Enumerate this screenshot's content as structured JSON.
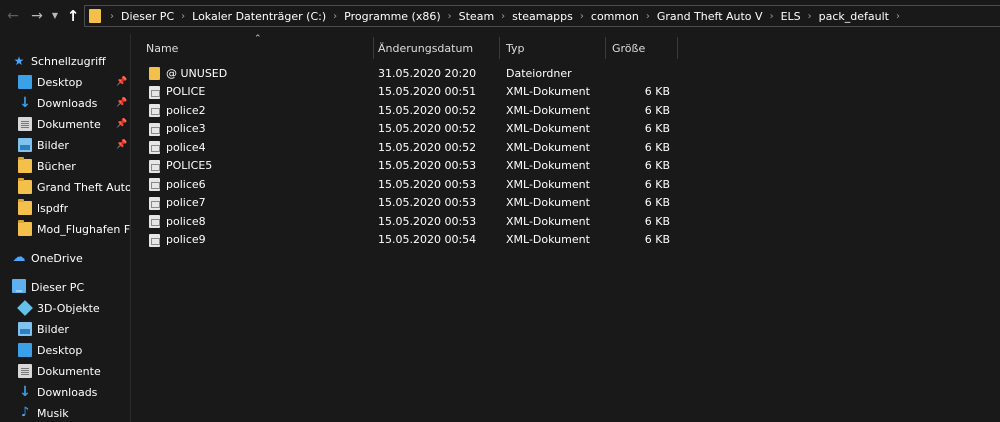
{
  "address_bar": {
    "crumbs": [
      "Dieser PC",
      "Lokaler Datenträger (C:)",
      "Programme (x86)",
      "Steam",
      "steamapps",
      "common",
      "Grand Theft Auto V",
      "ELS",
      "pack_default"
    ]
  },
  "sidebar": {
    "quick_access": {
      "label": "Schnellzugriff",
      "items": [
        {
          "label": "Desktop",
          "icon": "desktop-icon",
          "pinned": true
        },
        {
          "label": "Downloads",
          "icon": "download-icon",
          "pinned": true
        },
        {
          "label": "Dokumente",
          "icon": "document-icon",
          "pinned": true
        },
        {
          "label": "Bilder",
          "icon": "pictures-icon",
          "pinned": true
        },
        {
          "label": "Bücher",
          "icon": "folder-icon",
          "pinned": false
        },
        {
          "label": "Grand Theft Auto V",
          "icon": "folder-icon",
          "pinned": false
        },
        {
          "label": "lspdfr",
          "icon": "folder-icon",
          "pinned": false
        },
        {
          "label": "Mod_Flughafen FFM",
          "icon": "folder-icon",
          "pinned": false
        }
      ]
    },
    "onedrive": {
      "label": "OneDrive"
    },
    "this_pc": {
      "label": "Dieser PC",
      "items": [
        {
          "label": "3D-Objekte",
          "icon": "3d-objects-icon"
        },
        {
          "label": "Bilder",
          "icon": "pictures-icon"
        },
        {
          "label": "Desktop",
          "icon": "desktop-icon"
        },
        {
          "label": "Dokumente",
          "icon": "document-icon"
        },
        {
          "label": "Downloads",
          "icon": "download-icon"
        },
        {
          "label": "Musik",
          "icon": "music-icon"
        }
      ]
    }
  },
  "columns": {
    "name": "Name",
    "date": "Änderungsdatum",
    "type": "Typ",
    "size": "Größe"
  },
  "files": [
    {
      "name": "@ UNUSED",
      "date": "31.05.2020 20:20",
      "type": "Dateiordner",
      "size": "",
      "icon": "folder-icon"
    },
    {
      "name": "POLICE",
      "date": "15.05.2020 00:51",
      "type": "XML-Dokument",
      "size": "6 KB",
      "icon": "xml-file-icon"
    },
    {
      "name": "police2",
      "date": "15.05.2020 00:52",
      "type": "XML-Dokument",
      "size": "6 KB",
      "icon": "xml-file-icon"
    },
    {
      "name": "police3",
      "date": "15.05.2020 00:52",
      "type": "XML-Dokument",
      "size": "6 KB",
      "icon": "xml-file-icon"
    },
    {
      "name": "police4",
      "date": "15.05.2020 00:52",
      "type": "XML-Dokument",
      "size": "6 KB",
      "icon": "xml-file-icon"
    },
    {
      "name": "POLICE5",
      "date": "15.05.2020 00:53",
      "type": "XML-Dokument",
      "size": "6 KB",
      "icon": "xml-file-icon"
    },
    {
      "name": "police6",
      "date": "15.05.2020 00:53",
      "type": "XML-Dokument",
      "size": "6 KB",
      "icon": "xml-file-icon"
    },
    {
      "name": "police7",
      "date": "15.05.2020 00:53",
      "type": "XML-Dokument",
      "size": "6 KB",
      "icon": "xml-file-icon"
    },
    {
      "name": "police8",
      "date": "15.05.2020 00:53",
      "type": "XML-Dokument",
      "size": "6 KB",
      "icon": "xml-file-icon"
    },
    {
      "name": "police9",
      "date": "15.05.2020 00:54",
      "type": "XML-Dokument",
      "size": "6 KB",
      "icon": "xml-file-icon"
    }
  ],
  "colors": {
    "background": "#191919",
    "folder": "#f3c04c",
    "accent_blue": "#3aa0e8",
    "text": "#ffffff"
  }
}
